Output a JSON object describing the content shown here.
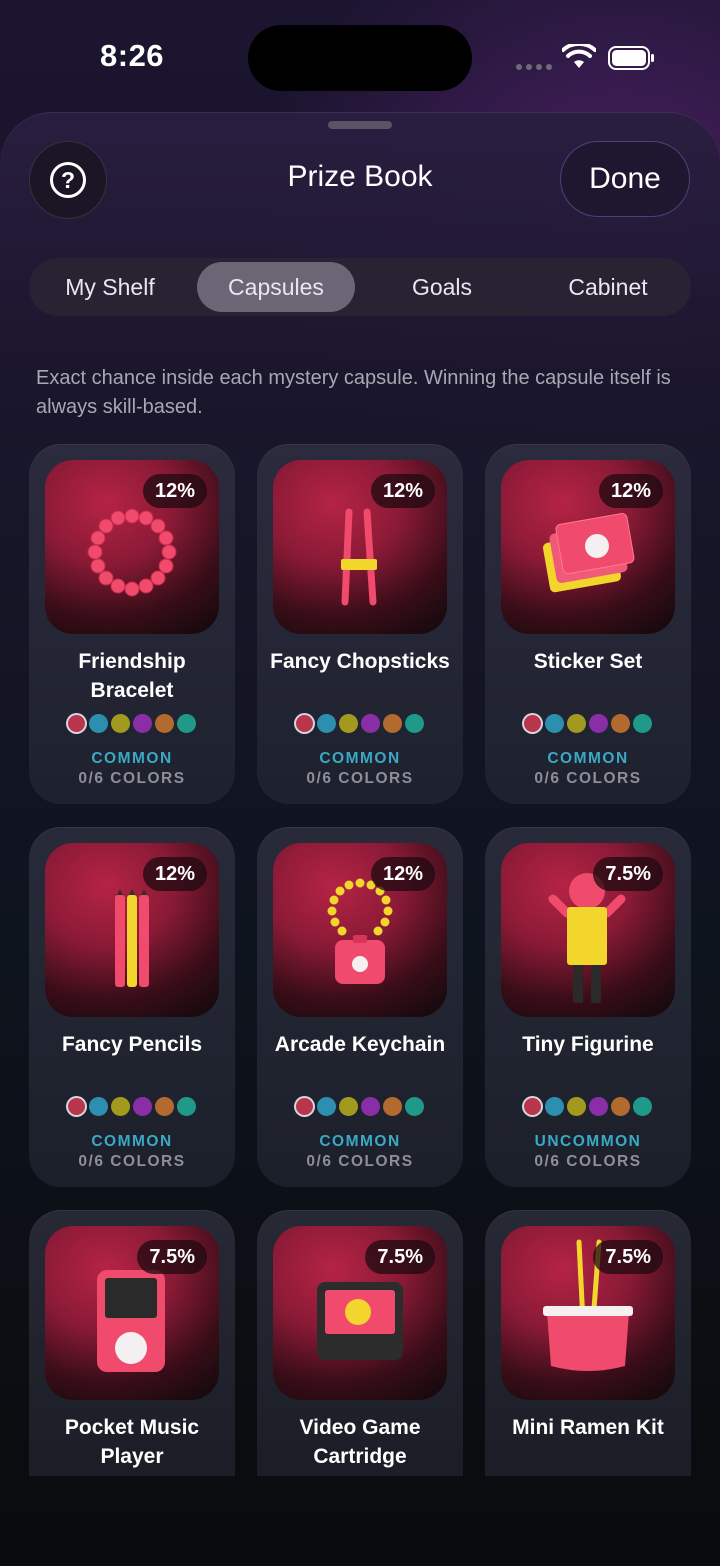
{
  "status": {
    "time": "8:26"
  },
  "header": {
    "title": "Prize Book",
    "done_label": "Done",
    "help_symbol": "?"
  },
  "tabs": [
    {
      "label": "My Shelf",
      "active": false
    },
    {
      "label": "Capsules",
      "active": true
    },
    {
      "label": "Goals",
      "active": false
    },
    {
      "label": "Cabinet",
      "active": false
    }
  ],
  "intro": "Exact chance inside each mystery capsule. Winning the capsule itself is always skill-based.",
  "swatch_colors": [
    "#b8354c",
    "#2d8fb0",
    "#a29a1e",
    "#8a2ea8",
    "#b36a2e",
    "#1f9a8a"
  ],
  "colors": {
    "accent_rarity": "#3aa9c6",
    "art_bg": "#9b1d3c",
    "product_pink": "#f0476a",
    "product_yellow": "#f3d62c"
  },
  "prizes": [
    {
      "name": "Friendship Bracelet",
      "chance": "12%",
      "rarity": "COMMON",
      "colors": "0/6 COLORS",
      "icon": "bracelet-icon"
    },
    {
      "name": "Fancy Chopsticks",
      "chance": "12%",
      "rarity": "COMMON",
      "colors": "0/6 COLORS",
      "icon": "chopsticks-icon"
    },
    {
      "name": "Sticker Set",
      "chance": "12%",
      "rarity": "COMMON",
      "colors": "0/6 COLORS",
      "icon": "sticker-set-icon"
    },
    {
      "name": "Fancy Pencils",
      "chance": "12%",
      "rarity": "COMMON",
      "colors": "0/6 COLORS",
      "icon": "pencils-icon"
    },
    {
      "name": "Arcade Keychain",
      "chance": "12%",
      "rarity": "COMMON",
      "colors": "0/6 COLORS",
      "icon": "keychain-icon"
    },
    {
      "name": "Tiny Figurine",
      "chance": "7.5%",
      "rarity": "UNCOMMON",
      "colors": "0/6 COLORS",
      "icon": "figurine-icon"
    },
    {
      "name": "Pocket Music Player",
      "chance": "7.5%",
      "icon": "music-player-icon"
    },
    {
      "name": "Video Game Cartridge",
      "chance": "7.5%",
      "icon": "game-cartridge-icon"
    },
    {
      "name": "Mini Ramen Kit",
      "chance": "7.5%",
      "icon": "ramen-kit-icon"
    }
  ]
}
